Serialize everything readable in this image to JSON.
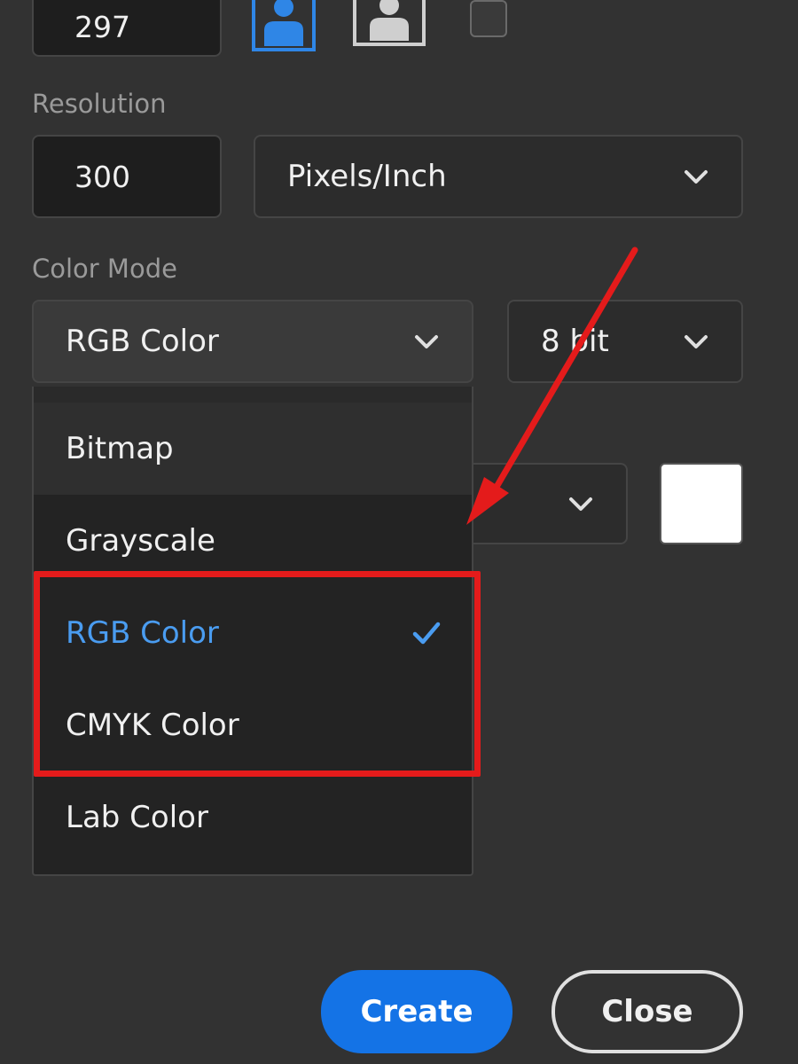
{
  "size_section": {
    "height_value": "297",
    "orientation": {
      "portrait_active": true,
      "portrait_color": "#2f86e6",
      "landscape_color": "#cfcfcf"
    }
  },
  "resolution": {
    "label": "Resolution",
    "value": "300",
    "unit_selected": "Pixels/Inch"
  },
  "color_mode": {
    "label": "Color Mode",
    "mode_selected": "RGB Color",
    "depth_selected": "8 bit",
    "dropdown": {
      "items": [
        {
          "label": "Bitmap",
          "state": "hover"
        },
        {
          "label": "Grayscale",
          "state": "normal"
        },
        {
          "label": "RGB Color",
          "state": "selected"
        },
        {
          "label": "CMYK Color",
          "state": "normal"
        },
        {
          "label": "Lab Color",
          "state": "normal"
        }
      ]
    }
  },
  "background": {
    "swatch_color": "#ffffff"
  },
  "buttons": {
    "create_label": "Create",
    "close_label": "Close"
  },
  "colors": {
    "accent": "#1473e6",
    "selected_text": "#4a9cf0",
    "annotation_red": "#e41b1b",
    "panel_bg": "#323232"
  }
}
